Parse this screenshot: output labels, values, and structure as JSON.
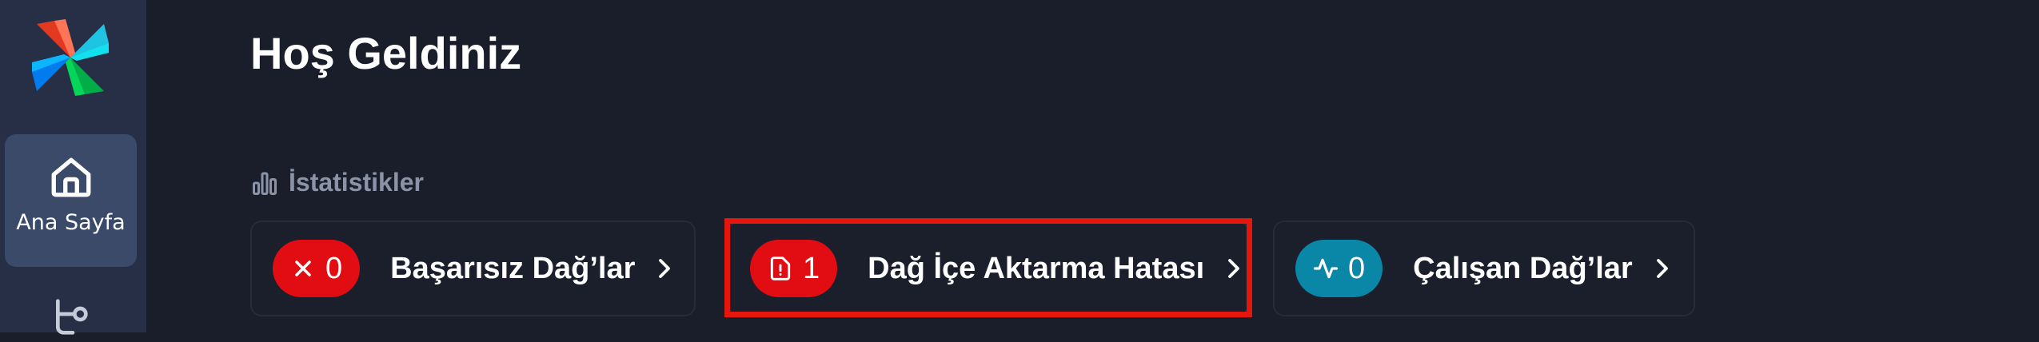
{
  "sidebar": {
    "logo_icon": "pinwheel-logo-icon",
    "items": [
      {
        "label": "Ana Sayfa",
        "icon": "home-icon",
        "active": true
      },
      {
        "label": "",
        "icon": "dags-icon",
        "active": false
      }
    ]
  },
  "main": {
    "title": "Hoş Geldiniz",
    "stats_heading": "İstatistikler",
    "stats_icon": "bar-chart-icon",
    "cards": [
      {
        "count": "0",
        "label": "Başarısız Dağ’lar",
        "icon": "x-icon",
        "color": "#e10d12"
      },
      {
        "count": "1",
        "label": "Dağ İçe Aktarma Hatası",
        "icon": "file-alert-icon",
        "color": "#e10d12"
      },
      {
        "count": "0",
        "label": "Çalışan Dağ’lar",
        "icon": "activity-icon",
        "color": "#0a86a6"
      }
    ]
  },
  "colors": {
    "background": "#1a1e2b",
    "sidebar": "#262f45",
    "sidebar_active": "#3b4a68",
    "highlight": "#e5170d"
  }
}
